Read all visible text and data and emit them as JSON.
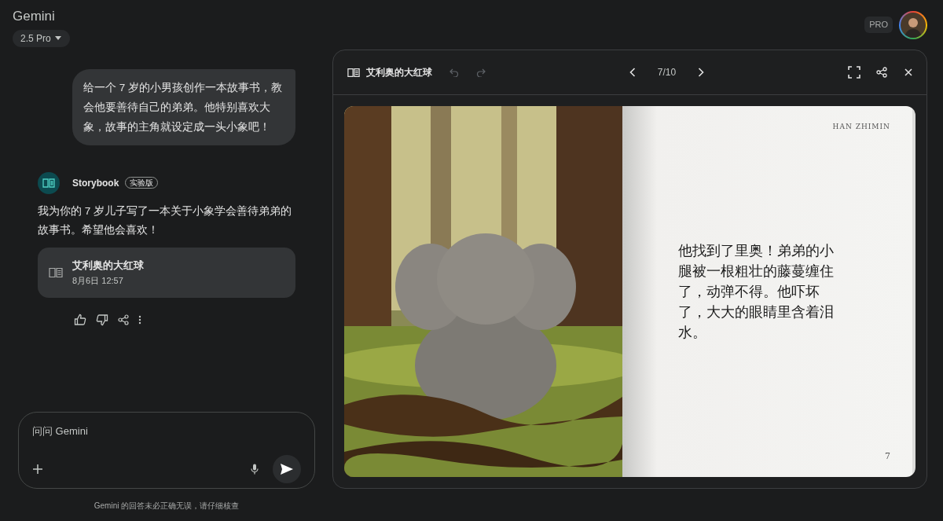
{
  "app": {
    "title": "Gemini",
    "model": "2.5 Pro",
    "badge": "PRO"
  },
  "chat": {
    "user_message": "给一个 7 岁的小男孩创作一本故事书，教会他要善待自己的弟弟。他特别喜欢大象，故事的主角就设定成一头小象吧！",
    "response": {
      "agent": "Storybook",
      "agent_badge": "实验版",
      "text": "我为你的 7 岁儿子写了一本关于小象学会善待弟弟的故事书。希望他会喜欢！",
      "card": {
        "title": "艾利奥的大红球",
        "date": "8月6日 12:57"
      }
    }
  },
  "composer": {
    "placeholder": "问问 Gemini",
    "disclaimer": "Gemini 的回答未必正确无误，请仔细核查"
  },
  "viewer": {
    "title": "艾利奥的大红球",
    "undo": {
      "disabled": true
    },
    "redo": {
      "disabled": true
    },
    "page_indicator": "7/10",
    "book": {
      "author": "HAN ZHIMIN",
      "text": "他找到了里奥！弟弟的小腿被一根粗壮的藤蔓缠住了，动弹不得。他吓坏了，大大的眼睛里含着泪水。",
      "page_number": "7"
    }
  }
}
